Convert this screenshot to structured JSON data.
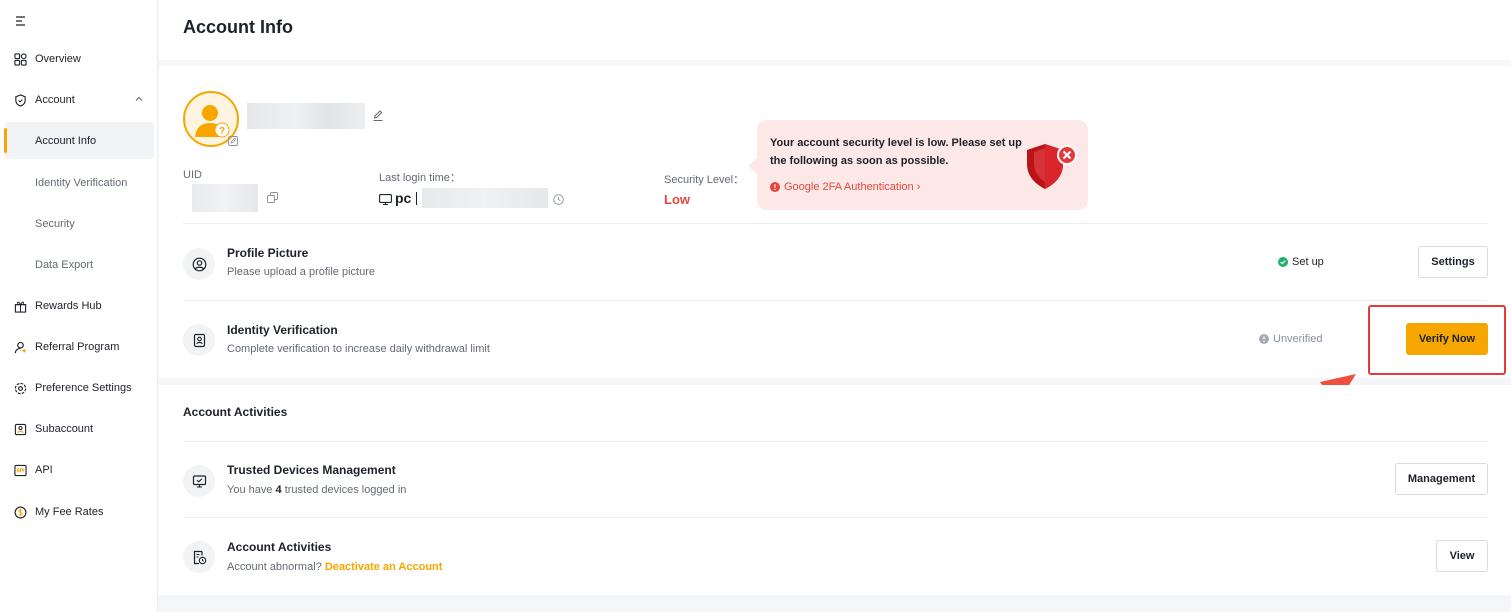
{
  "sidebar": {
    "items": [
      {
        "label": "Overview",
        "icon": "overview-icon"
      },
      {
        "label": "Account",
        "icon": "shield-account-icon",
        "expanded": true,
        "children": [
          "Account Info",
          "Identity Verification",
          "Security",
          "Data Export"
        ]
      },
      {
        "label": "Rewards Hub",
        "icon": "gift-icon"
      },
      {
        "label": "Referral Program",
        "icon": "referral-icon"
      },
      {
        "label": "Preference Settings",
        "icon": "gear-icon"
      },
      {
        "label": "Subaccount",
        "icon": "subaccount-icon"
      },
      {
        "label": "API",
        "icon": "api-icon"
      },
      {
        "label": "My Fee Rates",
        "icon": "fee-icon"
      }
    ],
    "active_item": "Account Info"
  },
  "header": {
    "title": "Account Info"
  },
  "profile": {
    "uid_label": "UID",
    "last_login_label": "Last login time：",
    "device": "pc",
    "security_level_label": "Security Level：",
    "security_level_value": "Low"
  },
  "security_warning": {
    "message": "Your account security level is low. Please set up the following as soon as possible.",
    "link": "Google 2FA Authentication ›"
  },
  "rows": {
    "profile_picture": {
      "title": "Profile Picture",
      "desc": "Please upload a profile picture",
      "status": "Set up",
      "button": "Settings"
    },
    "identity_verification": {
      "title": "Identity Verification",
      "desc": "Complete verification to increase daily withdrawal limit",
      "status": "Unverified",
      "button": "Verify Now"
    }
  },
  "activities": {
    "section_title": "Account Activities",
    "trusted_devices": {
      "title": "Trusted Devices Management",
      "desc_prefix": "You have ",
      "count": "4",
      "desc_suffix": " trusted devices logged in",
      "button": "Management"
    },
    "account_activities": {
      "title": "Account Activities",
      "desc_prefix": "Account abnormal? ",
      "link": "Deactivate an Account",
      "button": "View"
    }
  },
  "colors": {
    "brand": "#f7a600",
    "danger": "#e5473c",
    "success": "#20b26c",
    "highlight_box": "#e5393a"
  }
}
